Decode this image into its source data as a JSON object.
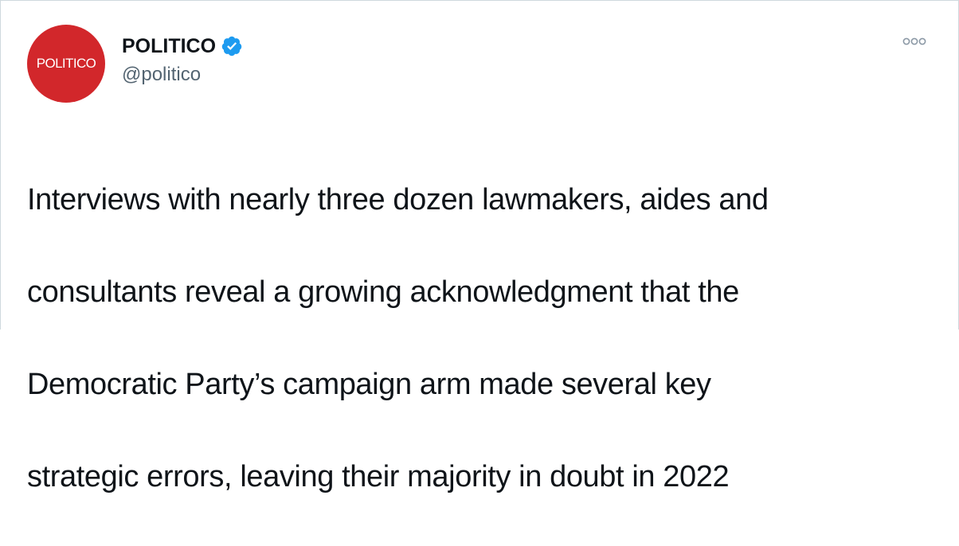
{
  "tweet": {
    "avatar": {
      "logo_text": "POLITICO",
      "color": "#d2272b"
    },
    "author": {
      "display_name": "POLITICO",
      "handle": "@politico",
      "verified": true,
      "verified_color": "#1d9bf0"
    },
    "menu_icon": "more-options-icon",
    "text_lines": [
      "Interviews with nearly three dozen lawmakers, aides and",
      "consultants reveal a growing acknowledgment that the",
      "Democratic Party’s campaign arm made several key",
      "strategic errors, leaving their majority in doubt in 2022"
    ]
  }
}
